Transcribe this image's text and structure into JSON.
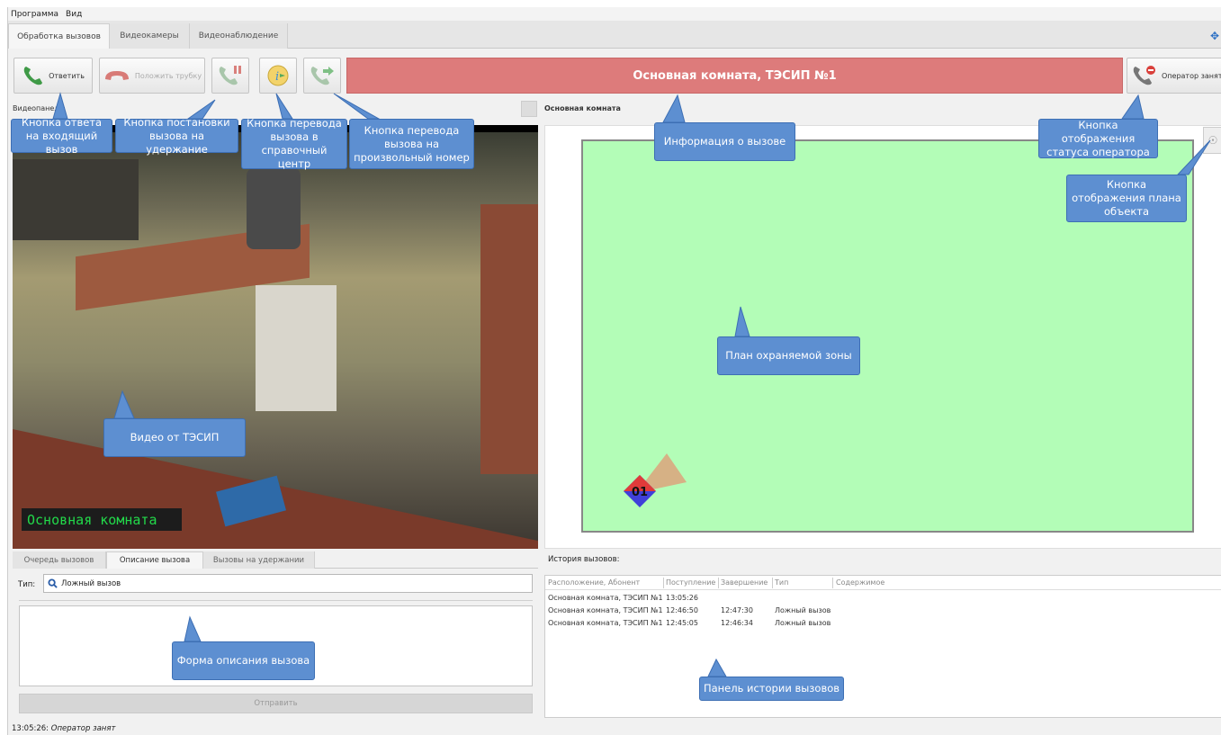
{
  "menu": [
    "Программа",
    "Вид"
  ],
  "main_tabs": [
    "Обработка вызовов",
    "Видеокамеры",
    "Видеонаблюдение"
  ],
  "toolbar": {
    "answer": "Ответить",
    "hangup": "Положить трубку",
    "operator_status": "Оператор занят"
  },
  "call_info": "Основная комната, ТЭСИП №1",
  "video_panel_label": "Видеопанель:",
  "plan_title": "Основная комната",
  "video_caption": "Основная комната",
  "sensor_label": "01",
  "subtabs": [
    "Очередь вызовов",
    "Описание вызова",
    "Вызовы на удержании"
  ],
  "form": {
    "type_label": "Тип:",
    "type_value": "Ложный вызов",
    "send": "Отправить"
  },
  "history": {
    "label": "История вызовов:",
    "columns": [
      "Расположение, Абонент",
      "Поступление",
      "Завершение",
      "Тип",
      "Содержимое"
    ],
    "rows": [
      {
        "location": "Основная комната, ТЭСИП №1",
        "start": "13:05:26",
        "end": "",
        "type": ""
      },
      {
        "location": "Основная комната, ТЭСИП №1",
        "start": "12:46:50",
        "end": "12:47:30",
        "type": "Ложный вызов"
      },
      {
        "location": "Основная комната, ТЭСИП №1",
        "start": "12:45:05",
        "end": "12:46:34",
        "type": "Ложный вызов"
      }
    ]
  },
  "status": {
    "time": "13:05:26:",
    "text": "Оператор занят"
  },
  "callouts": {
    "answer": "Кнопка ответа на входящий вызов",
    "hold": "Кнопка постановки вызова на удержание",
    "transfer_help": "Кнопка перевода вызова в справочный центр",
    "transfer_any": "Кнопка перевода вызова на произвольный номер",
    "call_info": "Информация о вызове",
    "operator_status": "Кнопка отображения статуса оператора",
    "plan_button": "Кнопка отображения плана объекта",
    "plan": "План охраняемой зоны",
    "video": "Видео от ТЭСИП",
    "form": "Форма описания вызова",
    "history": "Панель истории вызовов"
  },
  "colors": {
    "call_bar": "#dd7b7b",
    "plan_zone": "#b3fdb7",
    "callout": "#5d8fd1",
    "phone_green": "#3f9a47",
    "phone_red": "#c7504c"
  }
}
